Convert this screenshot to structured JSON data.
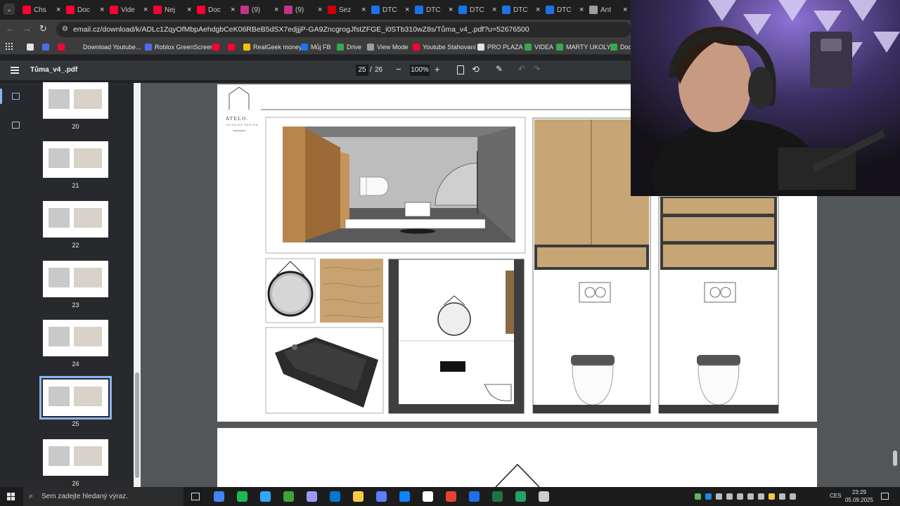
{
  "tabs": [
    {
      "label": "Chs",
      "color": "#ff0033"
    },
    {
      "label": "Doc",
      "color": "#ff0033"
    },
    {
      "label": "Vide",
      "color": "#ff0033"
    },
    {
      "label": "Nej",
      "color": "#ff0033"
    },
    {
      "label": "Doc",
      "color": "#ff0033"
    },
    {
      "label": "(9)",
      "color": "#c13584"
    },
    {
      "label": "(9)",
      "color": "#c13584"
    },
    {
      "label": "Sez",
      "color": "#cc0000"
    },
    {
      "label": "DTC",
      "color": "#1a73e8"
    },
    {
      "label": "DTC",
      "color": "#1a73e8"
    },
    {
      "label": "DTC",
      "color": "#1a73e8"
    },
    {
      "label": "DTC",
      "color": "#1a73e8"
    },
    {
      "label": "DTC",
      "color": "#1a73e8"
    },
    {
      "label": "Ant",
      "color": "#9e9e9e"
    }
  ],
  "address": {
    "url": "email.cz/download/k/ADLc1ZqyOfMbpAehdgbCeK06RBeB5dSX7edjjjP-GA9ZncgrogJfstZFGE_i0STb310wZ8s/Tůma_v4_.pdf?u=52676500"
  },
  "bookmarks": [
    {
      "label": "",
      "color": "#e3e3e3"
    },
    {
      "label": "",
      "color": "#4f6bed"
    },
    {
      "label": "",
      "color": "#ff0033"
    },
    {
      "label": "Download Youtube...",
      "color": "#3c3c3c"
    },
    {
      "label": "Roblox GreenScreen",
      "color": "#4f6bed"
    },
    {
      "label": "",
      "color": "#ff0033"
    },
    {
      "label": "",
      "color": "#ff0033"
    },
    {
      "label": "RealGeek money",
      "color": "#f4c20d"
    },
    {
      "label": "Můj FB",
      "color": "#1877f2"
    },
    {
      "label": "Drive",
      "color": "#34a853"
    },
    {
      "label": "View Mode",
      "color": "#9e9e9e"
    },
    {
      "label": "Youtube Stahovaní",
      "color": "#ff0033"
    },
    {
      "label": "PRO PLAZA",
      "color": "#e3e3e3"
    },
    {
      "label": "VIDEA",
      "color": "#34a853"
    },
    {
      "label": "MARTY UKOLY",
      "color": "#34a853"
    },
    {
      "label": "Dod",
      "color": "#34a853"
    }
  ],
  "pdf": {
    "filename": "Tůma_v4_.pdf",
    "current_page": "25",
    "separator": "/",
    "total_pages": "26",
    "zoom": "100%",
    "zoom_out": "−",
    "zoom_in": "+"
  },
  "thumbnails": [
    {
      "label": "20"
    },
    {
      "label": "21"
    },
    {
      "label": "22"
    },
    {
      "label": "23"
    },
    {
      "label": "24"
    },
    {
      "label": "25"
    },
    {
      "label": "26"
    }
  ],
  "page": {
    "logo_name": "ATELO.",
    "logo_sub": "INTERIOR DESIGN"
  },
  "taskbar": {
    "search_placeholder": "Sem zadejte hledaný výraz.",
    "lang": "CES",
    "time": "23:29",
    "date": "05.09.2025",
    "app_colors": [
      "#4285f4",
      "#1db954",
      "#31a8ff",
      "#3ea638",
      "#9999ff",
      "#0078d4",
      "#f7c948",
      "#5b7fff",
      "#0a84ff",
      "#ffffff",
      "#e94235",
      "#1f6feb",
      "#217346",
      "#21a366",
      "#cccccc"
    ]
  }
}
